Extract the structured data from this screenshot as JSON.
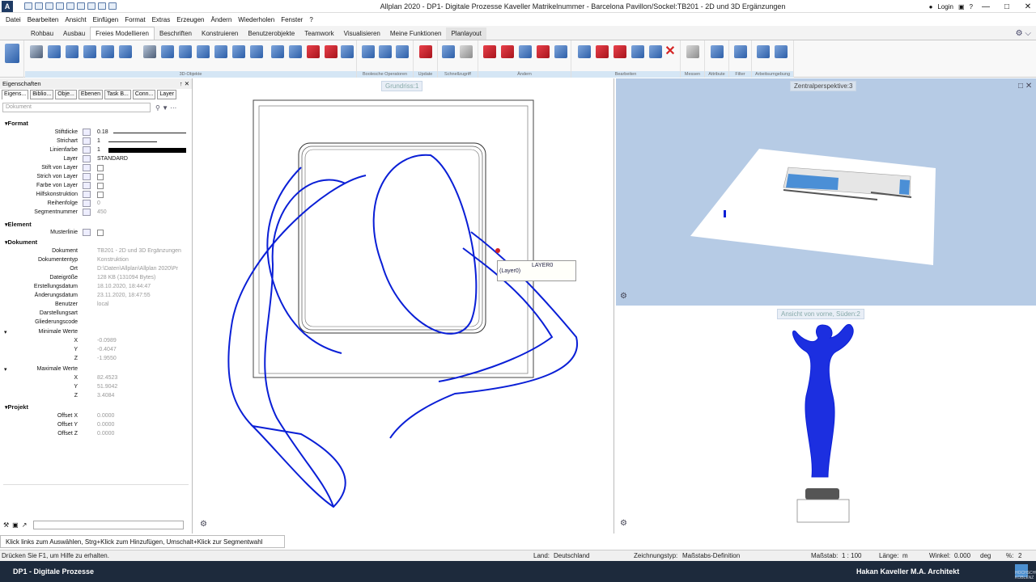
{
  "window": {
    "title": "Allplan 2020 - DP1- Digitale Prozesse Kaveller Matrikelnummer - Barcelona Pavillon/Sockel:TB201 - 2D und 3D Ergänzungen",
    "app_icon": "A",
    "login": "Login"
  },
  "menu": [
    "Datei",
    "Bearbeiten",
    "Ansicht",
    "Einfügen",
    "Format",
    "Extras",
    "Erzeugen",
    "Ändern",
    "Wiederholen",
    "Fenster",
    "?"
  ],
  "tabs": [
    "Rohbau",
    "Ausbau",
    "Freies Modellieren",
    "Beschriften",
    "Konstruieren",
    "Benutzerobjekte",
    "Teamwork",
    "Visualisieren",
    "Meine Funktionen",
    "Planlayout"
  ],
  "active_tab": "Freies Modellieren",
  "ribbon_groups": [
    "3D-Objekte",
    "Boolesche Operatoren",
    "Update",
    "Schnellzugriff",
    "Ändern",
    "Bearbeiten",
    "Messen",
    "Attribute",
    "Filter",
    "Arbeitsumgebung"
  ],
  "panel": {
    "title": "Eigenschaften",
    "pin": "↑",
    "close": "✕",
    "tabs": [
      "Eigens...",
      "Biblio...",
      "Obje...",
      "Ebenen",
      "Task B...",
      "Conn...",
      "Layer"
    ],
    "doc_placeholder": "Dokument",
    "sections": {
      "format": "Format",
      "element": "Element",
      "dokument": "Dokument",
      "projekt": "Projekt"
    },
    "format_props": [
      {
        "label": "Stiftdicke",
        "value": "0.18"
      },
      {
        "label": "Strichart",
        "value": "1"
      },
      {
        "label": "Linienfarbe",
        "value": "1"
      },
      {
        "label": "Layer",
        "value": "STANDARD"
      },
      {
        "label": "Stift von Layer",
        "value": ""
      },
      {
        "label": "Strich von Layer",
        "value": ""
      },
      {
        "label": "Farbe von Layer",
        "value": ""
      },
      {
        "label": "Hilfskonstruktion",
        "value": ""
      },
      {
        "label": "Reihenfolge",
        "value": "0"
      },
      {
        "label": "Segmentnummer",
        "value": "450"
      }
    ],
    "element_props": [
      {
        "label": "Musterlinie",
        "value": ""
      }
    ],
    "dokument_props": [
      {
        "label": "Dokument",
        "value": "TB201 - 2D und 3D Ergänzungen"
      },
      {
        "label": "Dokumententyp",
        "value": "Konstruktion"
      },
      {
        "label": "Ort",
        "value": "D:\\Daten\\Allplan\\Allplan 2020\\Pr"
      },
      {
        "label": "Dateigröße",
        "value": "128 KB (131094 Bytes)"
      },
      {
        "label": "Erstellungsdatum",
        "value": "18.10.2020, 18:44:47"
      },
      {
        "label": "Änderungsdatum",
        "value": "23.11.2020, 18:47:55"
      },
      {
        "label": "Benutzer",
        "value": "local"
      },
      {
        "label": "Darstellungsart",
        "value": ""
      },
      {
        "label": "Gliederungscode",
        "value": ""
      }
    ],
    "min_label": "Minimale Werte",
    "min": [
      {
        "label": "X",
        "value": "-0.0989"
      },
      {
        "label": "Y",
        "value": "-0.4047"
      },
      {
        "label": "Z",
        "value": "-1.9550"
      }
    ],
    "max_label": "Maximale Werte",
    "max": [
      {
        "label": "X",
        "value": "82.4523"
      },
      {
        "label": "Y",
        "value": "51.9042"
      },
      {
        "label": "Z",
        "value": "3.4084"
      }
    ],
    "projekt_props": [
      {
        "label": "Offset X",
        "value": "0.0000"
      },
      {
        "label": "Offset Y",
        "value": "0.0000"
      },
      {
        "label": "Offset Z",
        "value": "0.0000"
      }
    ]
  },
  "viewports": {
    "left": "Grundriss:1",
    "top_right": "Zentralperspektive:3",
    "bottom_right": "Ansicht von vorne, Süden:2"
  },
  "tooltip": {
    "line1": "LAYER0 (Layer0)"
  },
  "hint": "Klick links zum Auswählen, Strg+Klick zum Hinzufügen, Umschalt+Klick zur Segmentwahl",
  "status": {
    "help": "Drücken Sie F1, um Hilfe zu erhalten.",
    "land_label": "Land:",
    "land": "Deutschland",
    "zt_label": "Zeichnungstyp:",
    "zt": "Maßstabs-Definition",
    "ms_label": "Maßstab:",
    "ms": "1 : 100",
    "len_label": "Länge:",
    "len": "m",
    "angle_label": "Winkel:",
    "angle": "0.000",
    "angle_unit": "deg",
    "pct_label": "%:",
    "pct": "2"
  },
  "footer": {
    "left": "DP1 - Digitale Prozesse",
    "right": "Hakan Kaveller M.A. Architekt",
    "logo_text": "HOCHSCHULE KOBLENZ"
  },
  "colors": {
    "wire": "#0a1fd6",
    "accent": "#1d2a3c",
    "viewport_blue": "#b6cbe5"
  }
}
